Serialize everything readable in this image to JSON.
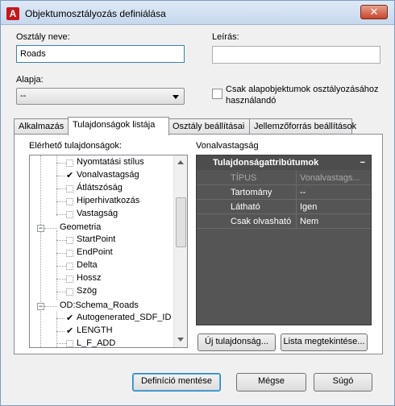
{
  "window": {
    "title": "Objektumosztályozás definiálása",
    "close_label": "✕",
    "app_icon_label": "A"
  },
  "form": {
    "class_name_label": "Osztály neve:",
    "class_name_value": "Roads",
    "description_label": "Leírás:",
    "description_value": "",
    "base_label": "Alapja:",
    "base_value": "--",
    "base_only_label_line1": "Csak alapobjektumok osztályozásához",
    "base_only_label_line2": "használandó",
    "base_only_checked": false
  },
  "tabs": [
    {
      "label": "Alkalmazás"
    },
    {
      "label": "Tulajdonságok listája"
    },
    {
      "label": "Osztály beállításai"
    },
    {
      "label": "Jellemzőforrás beállítások"
    }
  ],
  "properties_panel": {
    "available_label": "Elérhető tulajdonságok:",
    "tree": [
      {
        "label": "Nyomtatási stílus",
        "checked": false
      },
      {
        "label": "Vonalvastagság",
        "checked": true
      },
      {
        "label": "Átlátszóság",
        "checked": false
      },
      {
        "label": "Hiperhivatkozás",
        "checked": false
      },
      {
        "label": "Vastagság",
        "checked": false
      },
      {
        "label": "Geometria",
        "group": true
      },
      {
        "label": "StartPoint",
        "checked": false
      },
      {
        "label": "EndPoint",
        "checked": false
      },
      {
        "label": "Delta",
        "checked": false
      },
      {
        "label": "Hossz",
        "checked": false
      },
      {
        "label": "Szög",
        "checked": false
      },
      {
        "label": "OD:Schema_Roads",
        "group": true
      },
      {
        "label": "Autogenerated_SDF_ID",
        "checked": true
      },
      {
        "label": "LENGTH",
        "checked": true
      },
      {
        "label": "L_F_ADD",
        "checked": false
      }
    ],
    "selected_title": "Vonalvastagság",
    "attributes": {
      "header": "Tulajdonságattribútumok",
      "collapse_symbol": "−",
      "rows": [
        {
          "key": "TÍPUS",
          "value": "Vonalvastags...",
          "disabled": true
        },
        {
          "key": "Tartomány",
          "value": "--",
          "disabled": false
        },
        {
          "key": "Látható",
          "value": "Igen",
          "disabled": false
        },
        {
          "key": "Csak olvasható",
          "value": "Nem",
          "disabled": false
        }
      ]
    },
    "new_property_button": "Új tulajdonság...",
    "view_list_button": "Lista megtekintése..."
  },
  "footer": {
    "save_button": "Definíció mentése",
    "cancel_button": "Mégse",
    "help_button": "Súgó"
  }
}
